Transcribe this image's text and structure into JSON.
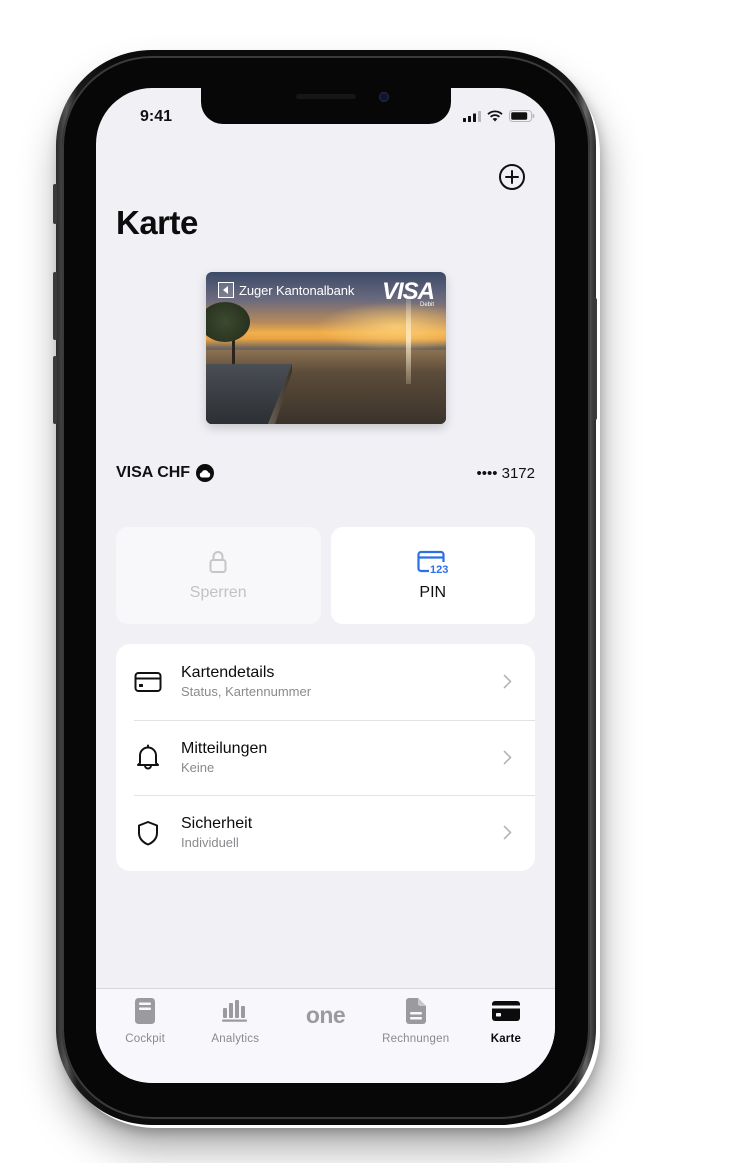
{
  "status_bar": {
    "time": "9:41"
  },
  "header": {
    "title": "Karte",
    "add_icon": "plus-circle-icon"
  },
  "card": {
    "bank_name": "Zuger Kantonalbank",
    "network": "VISA",
    "network_sub": "Debit",
    "name": "VISA CHF",
    "masked_number": "•••• 3172"
  },
  "actions": [
    {
      "label": "Sperren",
      "icon": "lock-icon",
      "enabled": false
    },
    {
      "label": "PIN",
      "icon": "card-pin-icon",
      "icon_text": "123",
      "enabled": true
    }
  ],
  "menu": [
    {
      "title": "Kartendetails",
      "subtitle": "Status, Kartennummer",
      "icon": "credit-card-icon"
    },
    {
      "title": "Mitteilungen",
      "subtitle": "Keine",
      "icon": "bell-icon"
    },
    {
      "title": "Sicherheit",
      "subtitle": "Individuell",
      "icon": "shield-icon"
    }
  ],
  "tabbar": {
    "items": [
      {
        "label": "Cockpit",
        "icon": "cockpit-icon",
        "active": false
      },
      {
        "label": "Analytics",
        "icon": "bar-chart-icon",
        "active": false
      },
      {
        "label": "one",
        "icon": "one-logo",
        "active": false
      },
      {
        "label": "Rechnungen",
        "icon": "document-icon",
        "active": false
      },
      {
        "label": "Karte",
        "icon": "card-icon",
        "active": true
      }
    ]
  },
  "colors": {
    "accent_blue": "#2f6fe6",
    "background": "#f1f0f5",
    "text_primary": "#0c0c0c",
    "text_secondary": "#8a8a8e",
    "disabled": "#c2c2c6"
  }
}
